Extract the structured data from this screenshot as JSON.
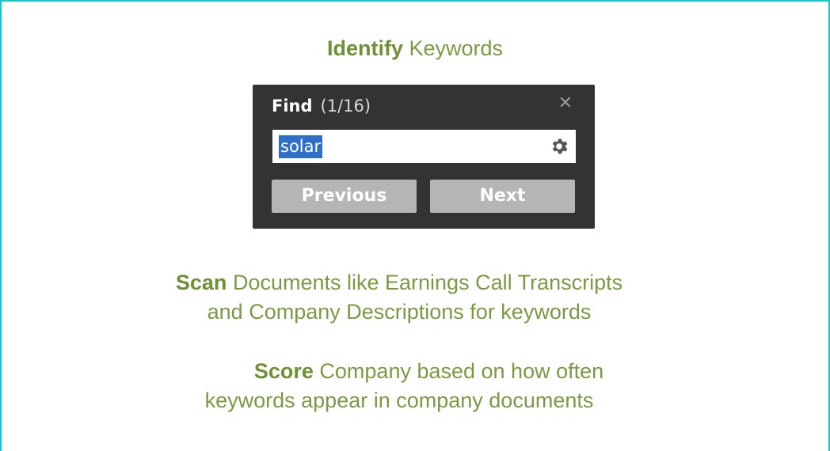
{
  "heading": {
    "bold": "Identify",
    "rest": "Keywords"
  },
  "find_panel": {
    "title": "Find",
    "count": "(1/16)",
    "close_icon": "close-icon",
    "search": {
      "value": "solar",
      "selected": true,
      "settings_icon": "gear-icon"
    },
    "previous_label": "Previous",
    "next_label": "Next"
  },
  "scan": {
    "bold": "Scan",
    "line1_rest": "Documents like Earnings Call Transcripts",
    "line2": "and Company Descriptions for keywords"
  },
  "score": {
    "bold": "Score",
    "line1_rest": "Company based on how often",
    "line2": "keywords appear in company documents"
  },
  "colors": {
    "border": "#1ec3c8",
    "green_text": "#7a9a44",
    "panel_bg": "#333333",
    "button_bg": "#b5b5b5",
    "selection": "#2f6fc9"
  }
}
